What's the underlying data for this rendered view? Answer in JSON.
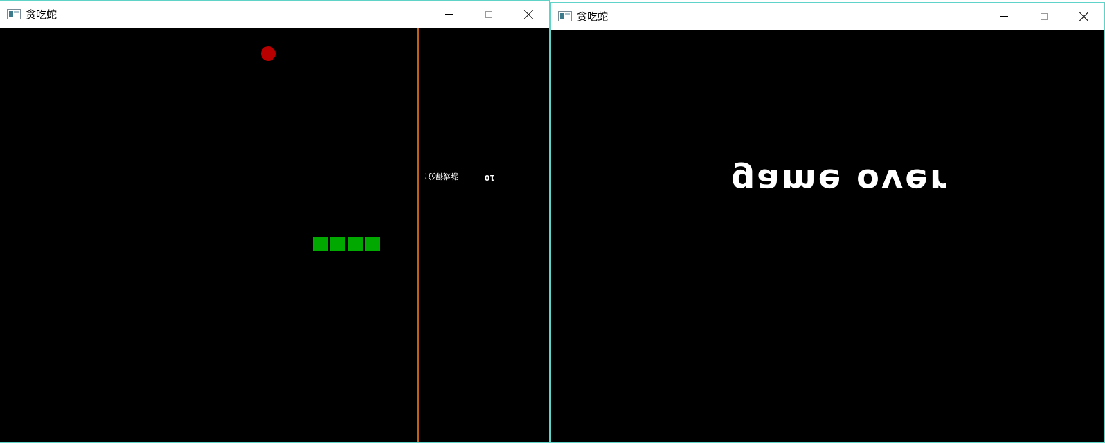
{
  "left_window": {
    "title": "贪吃蛇",
    "game": {
      "score_label": "游戏得分：",
      "score_value": "10",
      "snake_segment_count": 4,
      "colors": {
        "background": "#000000",
        "divider": "#c0601a",
        "food": "#b80000",
        "snake": "#00a800",
        "text": "#ffffff"
      }
    }
  },
  "right_window": {
    "title": "贪吃蛇",
    "game": {
      "message": "game over",
      "colors": {
        "background": "#000000",
        "text": "#ffffff"
      }
    }
  },
  "window_border_color": "#5fd3c8"
}
